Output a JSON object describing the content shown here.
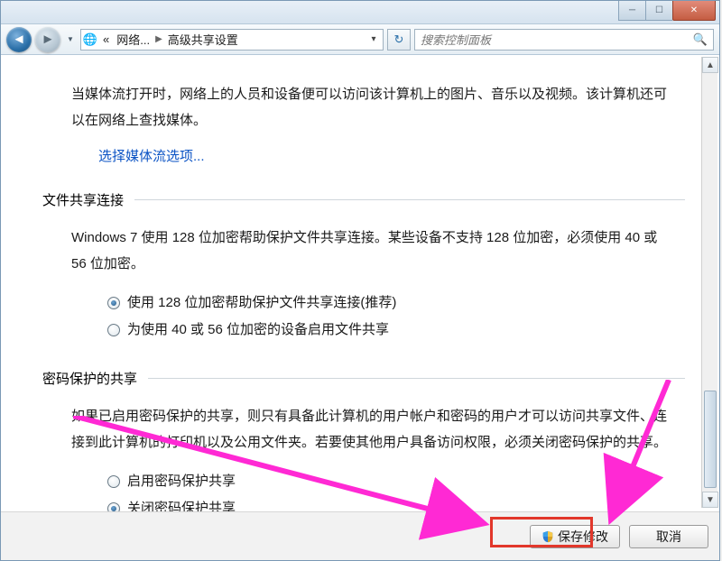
{
  "breadcrumb": {
    "prefix": "«",
    "item1": "网络...",
    "item2": "高级共享设置"
  },
  "search": {
    "placeholder": "搜索控制面板"
  },
  "media_section": {
    "para": "当媒体流打开时，网络上的人员和设备便可以访问该计算机上的图片、音乐以及视频。该计算机还可以在网络上查找媒体。",
    "link": "选择媒体流选项..."
  },
  "file_share": {
    "title": "文件共享连接",
    "para": "Windows 7 使用 128 位加密帮助保护文件共享连接。某些设备不支持 128 位加密，必须使用 40 或 56 位加密。",
    "radio1": "使用 128 位加密帮助保护文件共享连接(推荐)",
    "radio2": "为使用 40 或 56 位加密的设备启用文件共享"
  },
  "password": {
    "title": "密码保护的共享",
    "para": "如果已启用密码保护的共享，则只有具备此计算机的用户帐户和密码的用户才可以访问共享文件、连接到此计算机的打印机以及公用文件夹。若要使其他用户具备访问权限，必须关闭密码保护的共享。",
    "radio1": "启用密码保护共享",
    "radio2": "关闭密码保护共享"
  },
  "buttons": {
    "save": "保存修改",
    "cancel": "取消"
  }
}
